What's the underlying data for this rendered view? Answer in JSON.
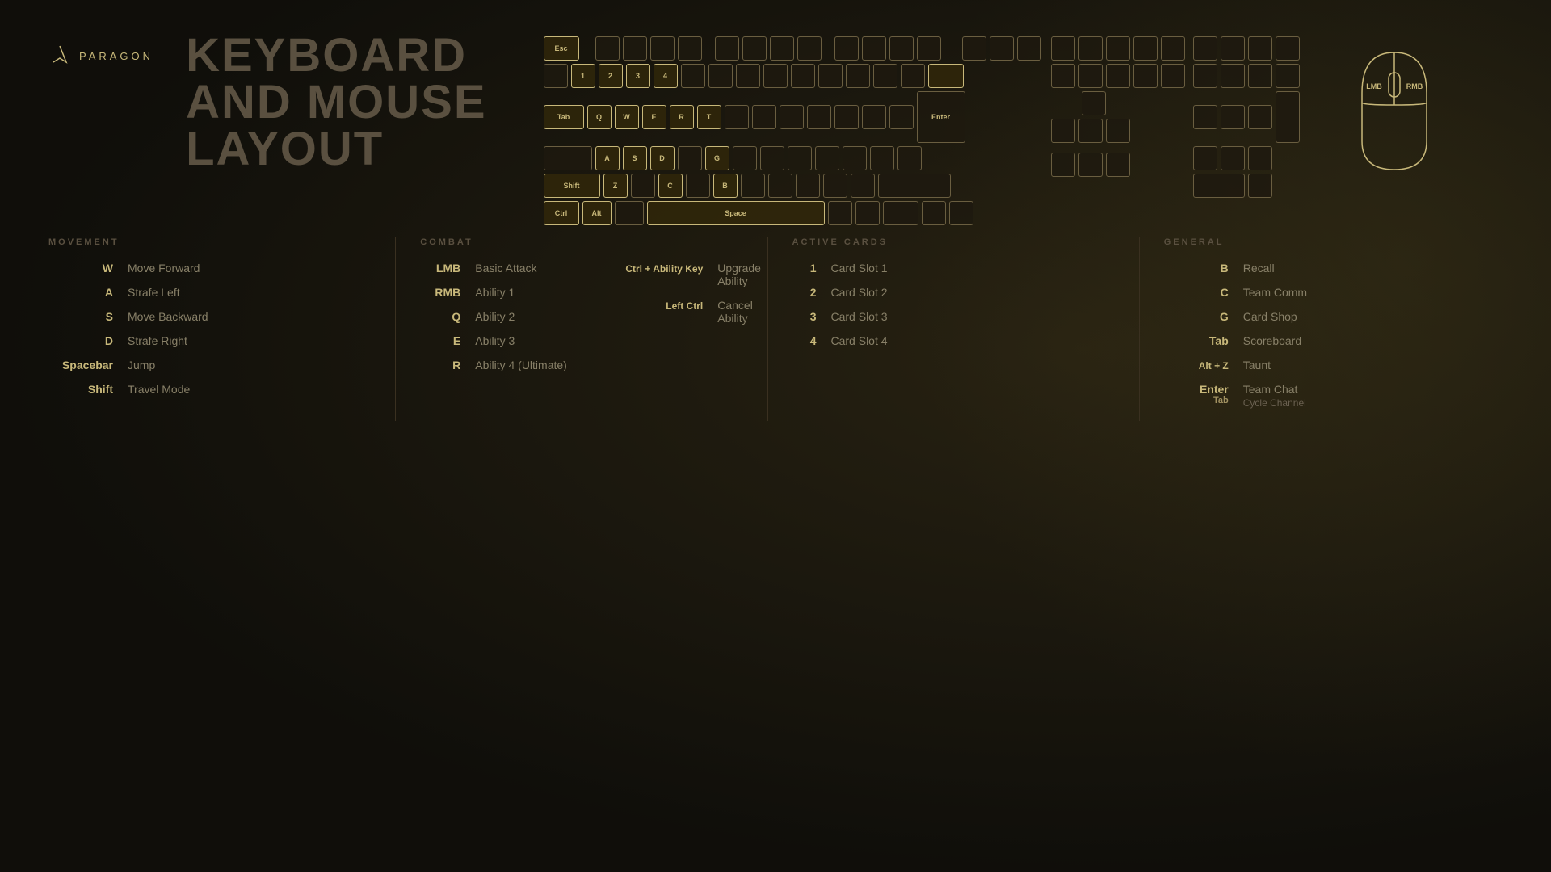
{
  "logo": {
    "text": "PARAGON"
  },
  "title": "KEYBOARD\nAND MOUSE\nLAYOUT",
  "sections": {
    "movement": {
      "label": "MOVEMENT",
      "bindings": [
        {
          "key": "W",
          "action": "Move Forward"
        },
        {
          "key": "A",
          "action": "Strafe Left"
        },
        {
          "key": "S",
          "action": "Move Backward"
        },
        {
          "key": "D",
          "action": "Strafe Right"
        },
        {
          "key": "Spacebar",
          "action": "Jump"
        },
        {
          "key": "Shift",
          "action": "Travel Mode"
        }
      ]
    },
    "combat": {
      "label": "COMBAT",
      "bindings": [
        {
          "key": "LMB",
          "action": "Basic Attack"
        },
        {
          "key": "RMB",
          "action": "Ability 1"
        },
        {
          "key": "Q",
          "action": "Ability 2"
        },
        {
          "key": "E",
          "action": "Ability 3"
        },
        {
          "key": "R",
          "action": "Ability 4 (Ultimate)"
        }
      ],
      "combo_bindings": [
        {
          "key": "Ctrl + Ability Key",
          "action": "Upgrade Ability"
        },
        {
          "key": "Left Ctrl",
          "action": "Cancel Ability"
        }
      ]
    },
    "active_cards": {
      "label": "ACTIVE CARDS",
      "bindings": [
        {
          "key": "1",
          "action": "Card Slot 1"
        },
        {
          "key": "2",
          "action": "Card Slot 2"
        },
        {
          "key": "3",
          "action": "Card Slot 3"
        },
        {
          "key": "4",
          "action": "Card Slot 4"
        }
      ]
    },
    "general": {
      "label": "GENERAL",
      "bindings": [
        {
          "key": "B",
          "action": "Recall"
        },
        {
          "key": "C",
          "action": "Team Comm"
        },
        {
          "key": "G",
          "action": "Card Shop"
        },
        {
          "key": "Tab",
          "action": "Scoreboard"
        },
        {
          "key": "Alt + Z",
          "action": "Taunt"
        },
        {
          "key_primary": "Enter",
          "action_primary": "Team Chat",
          "key_secondary": "Tab",
          "action_secondary": "Cycle Channel",
          "is_double": true
        }
      ]
    }
  },
  "mouse": {
    "lmb": "LMB",
    "rmb": "RMB"
  }
}
